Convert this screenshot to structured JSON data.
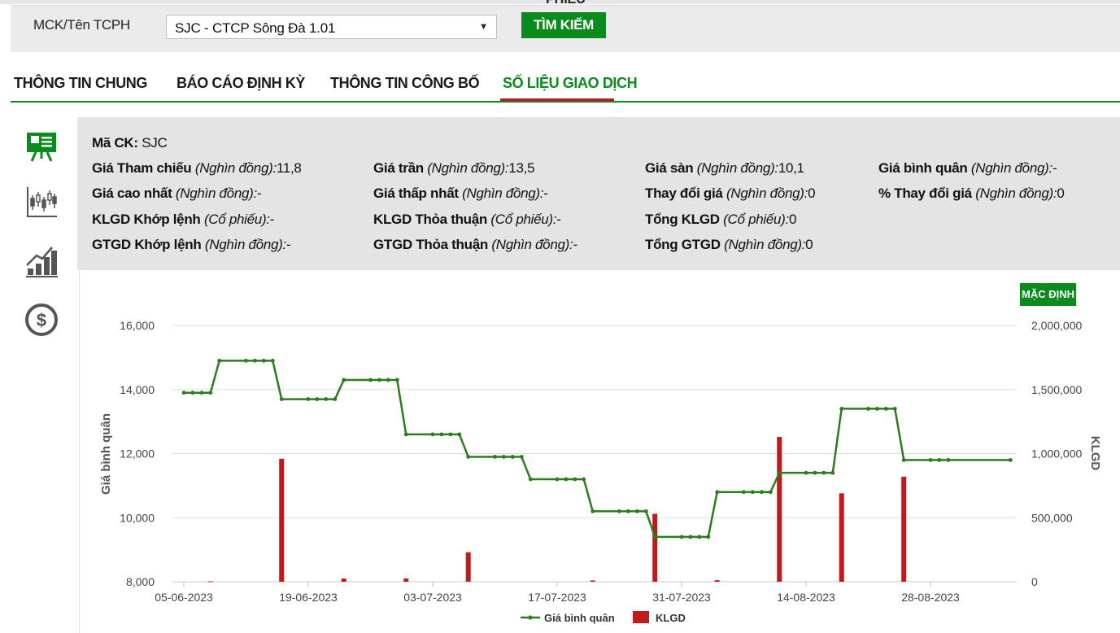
{
  "search": {
    "label": "MCK/Tên TCPH",
    "selected": "SJC - CTCP Sông Đà 1.01",
    "button": "TÌM KIẾM",
    "button_overflow": "PHIẾU"
  },
  "tabs": [
    {
      "label": "THÔNG TIN CHUNG",
      "active": false
    },
    {
      "label": "BÁO CÁO ĐỊNH KỲ",
      "active": false
    },
    {
      "label": "THÔNG TIN CÔNG BỐ",
      "active": false
    },
    {
      "label": "SỐ LIỆU GIAO DỊCH",
      "active": true
    }
  ],
  "side_icons": [
    "presentation-board-icon",
    "candlestick-chart-icon",
    "bar-chart-trend-icon",
    "dollar-coin-icon"
  ],
  "info": {
    "ticker_label": "Mã CK:",
    "ticker": "SJC",
    "rows": [
      [
        {
          "label": "Giá Tham chiếu",
          "unit": "(Nghìn đồng):",
          "value": "11,8"
        },
        {
          "label": "Giá trần",
          "unit": "(Nghìn đồng):",
          "value": "13,5"
        },
        {
          "label": "Giá sàn",
          "unit": "(Nghìn đồng):",
          "value": "10,1"
        },
        {
          "label": "Giá bình quân",
          "unit": "(Nghìn đồng):",
          "value": "-"
        }
      ],
      [
        {
          "label": "Giá cao nhất",
          "unit": "(Nghìn đồng):",
          "value": "-"
        },
        {
          "label": "Giá thấp nhất",
          "unit": "(Nghìn đồng):",
          "value": "-"
        },
        {
          "label": "Thay đổi giá",
          "unit": "(Nghìn đồng):",
          "value": "0"
        },
        {
          "label": "% Thay đổi giá",
          "unit": "(Nghìn đồng):",
          "value": "0"
        }
      ],
      [
        {
          "label": "KLGD Khớp lệnh",
          "unit": "(Cổ phiếu):",
          "value": "-"
        },
        {
          "label": "KLGD Thỏa thuận",
          "unit": "(Cổ phiếu):",
          "value": "-"
        },
        {
          "label": "Tổng KLGD",
          "unit": "(Cổ phiếu):",
          "value": "0"
        }
      ],
      [
        {
          "label": "GTGD Khớp lệnh",
          "unit": "(Nghìn đồng):",
          "value": "-"
        },
        {
          "label": "GTGD Thỏa thuận",
          "unit": "(Nghìn đồng):",
          "value": "-"
        },
        {
          "label": "Tổng GTGD",
          "unit": "(Nghìn đồng):",
          "value": "0"
        }
      ]
    ]
  },
  "chart_button": "MẶC ĐỊNH",
  "colors": {
    "accent": "#0b8a1d",
    "tab_underline": "#c8102e",
    "line": "#2a7d1d",
    "bars": "#c01a1a"
  },
  "chart_data": {
    "type": "line+bar",
    "start_date": "2023-06-05",
    "x_tick_labels": [
      "05-06-2023",
      "19-06-2023",
      "03-07-2023",
      "17-07-2023",
      "31-07-2023",
      "14-08-2023",
      "28-08-2023"
    ],
    "ylabel_left": "Giá bình quân",
    "ylabel_right": "KLGD",
    "y_left_ticks": [
      "8,000",
      "10,000",
      "12,000",
      "14,000",
      "16,000"
    ],
    "y_right_ticks": [
      "0",
      "500,000",
      "1,000,000",
      "1,500,000",
      "2,000,000"
    ],
    "ylim_left": [
      8000,
      16000
    ],
    "ylim_right": [
      0,
      2000000
    ],
    "grid": true,
    "legend_position": "bottom-center",
    "series": [
      {
        "name": "Giá bình quân",
        "type": "line",
        "points": [
          [
            "2023-06-05",
            13900
          ],
          [
            "2023-06-06",
            13900
          ],
          [
            "2023-06-07",
            13900
          ],
          [
            "2023-06-08",
            13900
          ],
          [
            "2023-06-09",
            14900
          ],
          [
            "2023-06-12",
            14900
          ],
          [
            "2023-06-13",
            14900
          ],
          [
            "2023-06-14",
            14900
          ],
          [
            "2023-06-15",
            14900
          ],
          [
            "2023-06-16",
            13700
          ],
          [
            "2023-06-19",
            13700
          ],
          [
            "2023-06-20",
            13700
          ],
          [
            "2023-06-21",
            13700
          ],
          [
            "2023-06-22",
            13700
          ],
          [
            "2023-06-23",
            14300
          ],
          [
            "2023-06-26",
            14300
          ],
          [
            "2023-06-27",
            14300
          ],
          [
            "2023-06-28",
            14300
          ],
          [
            "2023-06-29",
            14300
          ],
          [
            "2023-06-30",
            12600
          ],
          [
            "2023-07-03",
            12600
          ],
          [
            "2023-07-04",
            12600
          ],
          [
            "2023-07-05",
            12600
          ],
          [
            "2023-07-06",
            12600
          ],
          [
            "2023-07-07",
            11900
          ],
          [
            "2023-07-10",
            11900
          ],
          [
            "2023-07-11",
            11900
          ],
          [
            "2023-07-12",
            11900
          ],
          [
            "2023-07-13",
            11900
          ],
          [
            "2023-07-14",
            11200
          ],
          [
            "2023-07-17",
            11200
          ],
          [
            "2023-07-18",
            11200
          ],
          [
            "2023-07-19",
            11200
          ],
          [
            "2023-07-20",
            11200
          ],
          [
            "2023-07-21",
            10200
          ],
          [
            "2023-07-24",
            10200
          ],
          [
            "2023-07-25",
            10200
          ],
          [
            "2023-07-26",
            10200
          ],
          [
            "2023-07-27",
            10200
          ],
          [
            "2023-07-28",
            9400
          ],
          [
            "2023-07-31",
            9400
          ],
          [
            "2023-08-01",
            9400
          ],
          [
            "2023-08-02",
            9400
          ],
          [
            "2023-08-03",
            9400
          ],
          [
            "2023-08-04",
            10800
          ],
          [
            "2023-08-07",
            10800
          ],
          [
            "2023-08-08",
            10800
          ],
          [
            "2023-08-09",
            10800
          ],
          [
            "2023-08-10",
            10800
          ],
          [
            "2023-08-11",
            11400
          ],
          [
            "2023-08-14",
            11400
          ],
          [
            "2023-08-15",
            11400
          ],
          [
            "2023-08-16",
            11400
          ],
          [
            "2023-08-17",
            11400
          ],
          [
            "2023-08-18",
            13400
          ],
          [
            "2023-08-21",
            13400
          ],
          [
            "2023-08-22",
            13400
          ],
          [
            "2023-08-23",
            13400
          ],
          [
            "2023-08-24",
            13400
          ],
          [
            "2023-08-25",
            11800
          ],
          [
            "2023-08-28",
            11800
          ],
          [
            "2023-08-29",
            11800
          ],
          [
            "2023-08-30",
            11800
          ],
          [
            "2023-09-06",
            11800
          ]
        ]
      },
      {
        "name": "KLGD",
        "type": "bar",
        "points": [
          [
            "2023-06-08",
            3000
          ],
          [
            "2023-06-16",
            960000
          ],
          [
            "2023-06-23",
            25000
          ],
          [
            "2023-06-30",
            25000
          ],
          [
            "2023-07-07",
            230000
          ],
          [
            "2023-07-21",
            10000
          ],
          [
            "2023-07-28",
            530000
          ],
          [
            "2023-08-04",
            12000
          ],
          [
            "2023-08-11",
            1130000
          ],
          [
            "2023-08-18",
            690000
          ],
          [
            "2023-08-25",
            820000
          ]
        ]
      }
    ]
  }
}
